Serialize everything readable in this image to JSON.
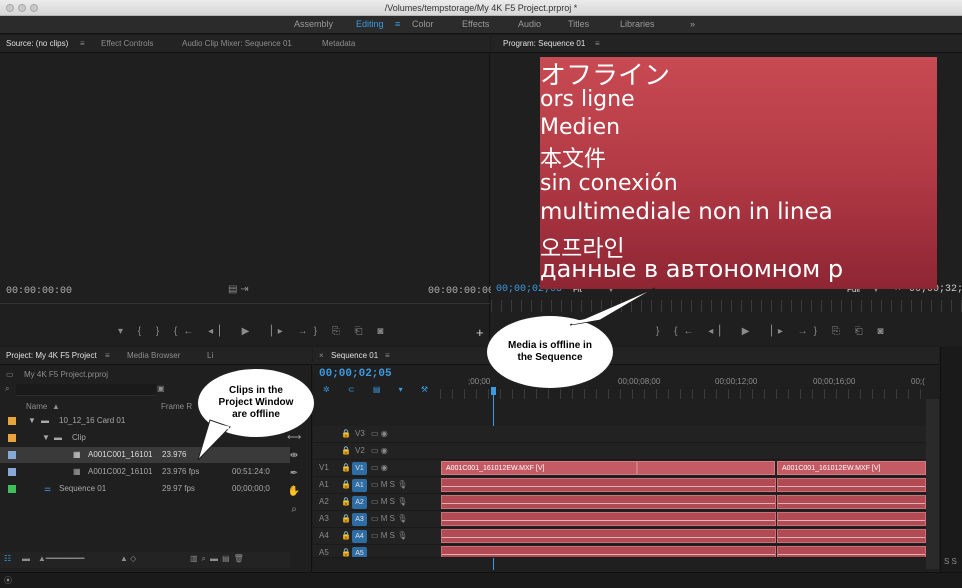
{
  "window": {
    "title": "/Volumes/tempstorage/My 4K F5 Project.prproj *"
  },
  "workspaces": {
    "items": [
      "Assembly",
      "Editing",
      "Color",
      "Effects",
      "Audio",
      "Titles",
      "Libraries"
    ],
    "active": "Editing",
    "more": "»",
    "menu_glyph": "≡"
  },
  "source": {
    "tabs": [
      "Source: (no clips)",
      "≡",
      "Effect Controls",
      "Audio Clip Mixer: Sequence 01",
      "Metadata"
    ],
    "tc_left": "00:00:00:00",
    "tc_right": "00:00:00:00"
  },
  "program": {
    "tab": "Program: Sequence 01",
    "tab_menu": "≡",
    "offline_lines": [
      "オフライン",
      "ors ligne",
      "Medien",
      "本文件",
      "sin conexión",
      "multimediale non in linea",
      "오프라인",
      "данные в автономном р"
    ],
    "tc": "00;00;02;05",
    "fit": "Fit",
    "fit_arrow": "▼",
    "quality": "Full",
    "quality_arrow": "▼",
    "wrench": "🔧",
    "tc_right": "00;00;32;"
  },
  "project": {
    "tabs": [
      "Project: My 4K F5 Project",
      "≡",
      "Media Browser",
      "Li"
    ],
    "file": "My 4K F5 Project.prproj",
    "col_name": "Name",
    "sort": "▲",
    "col_fr": "Frame R",
    "rows": [
      {
        "name": "10_12_16 Card 01",
        "fps": "",
        "dur": "",
        "color": "#e8a33c"
      },
      {
        "name": "Clip",
        "fps": "",
        "dur": "",
        "color": "#e8a33c"
      },
      {
        "name": "A001C001_16101",
        "fps": "23.976",
        "dur": "",
        "color": "#8aa8d6"
      },
      {
        "name": "A001C002_16101",
        "fps": "23.976 fps",
        "dur": "00:51:24:0",
        "color": "#8aa8d6"
      },
      {
        "name": "Sequence 01",
        "fps": "29.97 fps",
        "dur": "00;00;00;0",
        "color": "#3fbf5a"
      }
    ]
  },
  "timeline": {
    "tab": "Sequence 01",
    "close": "×",
    "menu": "≡",
    "tc": "00;00;02;05",
    "ruler": [
      ";00;00",
      "00;00;08;00",
      "00;00;12;00",
      "00;00;16;00",
      "00;("
    ],
    "video_tracks": [
      "V3",
      "V2",
      "V1"
    ],
    "audio_tracks": [
      "A1",
      "A2",
      "A3",
      "A4",
      "A5"
    ],
    "clip_label": "A001C001_161012EW.MXF [V]",
    "clip_label2": "A001C001_161012EW.MXF [V]",
    "ms": "M S"
  },
  "callouts": {
    "project": "Clips in the Project Window are offline",
    "sequence": "Media is offline in the Sequence"
  },
  "footer": {
    "meter": "S S"
  }
}
